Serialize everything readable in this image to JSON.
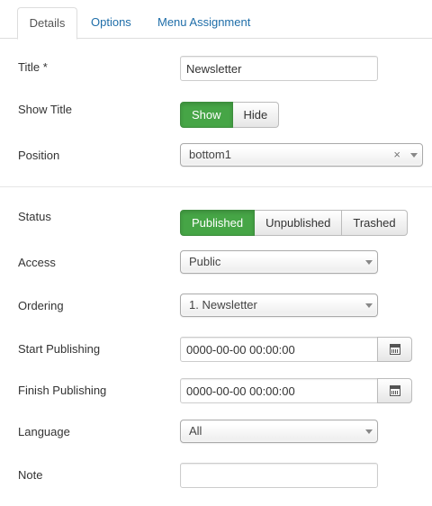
{
  "tabs": [
    {
      "label": "Details",
      "active": true
    },
    {
      "label": "Options",
      "active": false
    },
    {
      "label": "Menu Assignment",
      "active": false
    }
  ],
  "fields": {
    "title": {
      "label": "Title *",
      "value": "Newsletter"
    },
    "show_title": {
      "label": "Show Title",
      "options": [
        "Show",
        "Hide"
      ],
      "selected": "Show"
    },
    "position": {
      "label": "Position",
      "value": "bottom1",
      "clear_icon": "×"
    },
    "status": {
      "label": "Status",
      "options": [
        "Published",
        "Unpublished",
        "Trashed"
      ],
      "selected": "Published"
    },
    "access": {
      "label": "Access",
      "value": "Public"
    },
    "ordering": {
      "label": "Ordering",
      "value": "1. Newsletter"
    },
    "start_publishing": {
      "label": "Start Publishing",
      "value": "0000-00-00 00:00:00",
      "icon": "calendar-icon"
    },
    "finish_publishing": {
      "label": "Finish Publishing",
      "value": "0000-00-00 00:00:00",
      "icon": "calendar-icon"
    },
    "language": {
      "label": "Language",
      "value": "All"
    },
    "note": {
      "label": "Note",
      "value": ""
    }
  },
  "colors": {
    "active_green": "#46a546",
    "link_blue": "#1f6ea9"
  }
}
